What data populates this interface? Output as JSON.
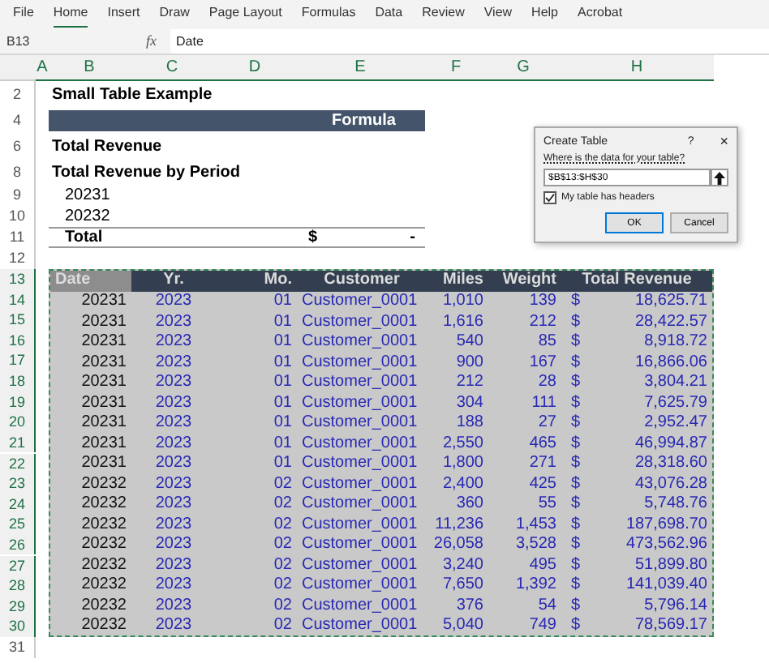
{
  "menu_tabs": [
    {
      "label": "File",
      "selected": false
    },
    {
      "label": "Home",
      "selected": true
    },
    {
      "label": "Insert",
      "selected": false
    },
    {
      "label": "Draw",
      "selected": false
    },
    {
      "label": "Page Layout",
      "selected": false
    },
    {
      "label": "Formulas",
      "selected": false
    },
    {
      "label": "Data",
      "selected": false
    },
    {
      "label": "Review",
      "selected": false
    },
    {
      "label": "View",
      "selected": false
    },
    {
      "label": "Help",
      "selected": false
    },
    {
      "label": "Acrobat",
      "selected": false
    }
  ],
  "formula_bar": {
    "name_box": "B13",
    "fx": "fx",
    "value": "Date"
  },
  "columns": [
    "A",
    "B",
    "C",
    "D",
    "E",
    "F",
    "G",
    "H"
  ],
  "rows": [
    {
      "num": "2",
      "kind": "title",
      "text": "Small Table Example"
    },
    {
      "num": "4",
      "kind": "band",
      "text": "Formula"
    },
    {
      "num": "6",
      "kind": "label",
      "text": "Total Revenue"
    },
    {
      "num": "8",
      "kind": "label",
      "text": "Total Revenue by Period"
    },
    {
      "num": "9",
      "kind": "period",
      "text": "20231"
    },
    {
      "num": "10",
      "kind": "period",
      "text": "20232"
    },
    {
      "num": "11",
      "kind": "total",
      "text": "Total",
      "currency": "$",
      "value": "-"
    },
    {
      "num": "12",
      "kind": "blank"
    }
  ],
  "table": {
    "header_row": "13",
    "columns": [
      {
        "label": "Date",
        "selected": true
      },
      {
        "label": "Yr.",
        "selected": false
      },
      {
        "label": "Mo.",
        "selected": false
      },
      {
        "label": "Customer",
        "selected": false
      },
      {
        "label": "Miles",
        "selected": false
      },
      {
        "label": "Weight",
        "selected": false
      },
      {
        "label": "Total Revenue",
        "selected": false
      }
    ],
    "rows": [
      {
        "num": "14",
        "cells": [
          "20231",
          "2023",
          "01",
          "Customer_0001",
          "1,010",
          "139",
          "18,625.71"
        ],
        "currency": "$"
      },
      {
        "num": "15",
        "cells": [
          "20231",
          "2023",
          "01",
          "Customer_0001",
          "1,616",
          "212",
          "28,422.57"
        ],
        "currency": "$"
      },
      {
        "num": "16",
        "cells": [
          "20231",
          "2023",
          "01",
          "Customer_0001",
          "540",
          "85",
          "8,918.72"
        ],
        "currency": "$"
      },
      {
        "num": "17",
        "cells": [
          "20231",
          "2023",
          "01",
          "Customer_0001",
          "900",
          "167",
          "16,866.06"
        ],
        "currency": "$"
      },
      {
        "num": "18",
        "cells": [
          "20231",
          "2023",
          "01",
          "Customer_0001",
          "212",
          "28",
          "3,804.21"
        ],
        "currency": "$"
      },
      {
        "num": "19",
        "cells": [
          "20231",
          "2023",
          "01",
          "Customer_0001",
          "304",
          "111",
          "7,625.79"
        ],
        "currency": "$"
      },
      {
        "num": "20",
        "cells": [
          "20231",
          "2023",
          "01",
          "Customer_0001",
          "188",
          "27",
          "2,952.47"
        ],
        "currency": "$"
      },
      {
        "num": "21",
        "cells": [
          "20231",
          "2023",
          "01",
          "Customer_0001",
          "2,550",
          "465",
          "46,994.87"
        ],
        "currency": "$"
      },
      {
        "num": "22",
        "cells": [
          "20231",
          "2023",
          "01",
          "Customer_0001",
          "1,800",
          "271",
          "28,318.60"
        ],
        "currency": "$"
      },
      {
        "num": "23",
        "cells": [
          "20232",
          "2023",
          "02",
          "Customer_0001",
          "2,400",
          "425",
          "43,076.28"
        ],
        "currency": "$"
      },
      {
        "num": "24",
        "cells": [
          "20232",
          "2023",
          "02",
          "Customer_0001",
          "360",
          "55",
          "5,748.76"
        ],
        "currency": "$"
      },
      {
        "num": "25",
        "cells": [
          "20232",
          "2023",
          "02",
          "Customer_0001",
          "11,236",
          "1,453",
          "187,698.70"
        ],
        "currency": "$"
      },
      {
        "num": "26",
        "cells": [
          "20232",
          "2023",
          "02",
          "Customer_0001",
          "26,058",
          "3,528",
          "473,562.96"
        ],
        "currency": "$"
      },
      {
        "num": "27",
        "cells": [
          "20232",
          "2023",
          "02",
          "Customer_0001",
          "3,240",
          "495",
          "51,899.80"
        ],
        "currency": "$"
      },
      {
        "num": "28",
        "cells": [
          "20232",
          "2023",
          "02",
          "Customer_0001",
          "7,650",
          "1,392",
          "141,039.40"
        ],
        "currency": "$"
      },
      {
        "num": "29",
        "cells": [
          "20232",
          "2023",
          "02",
          "Customer_0001",
          "376",
          "54",
          "5,796.14"
        ],
        "currency": "$"
      },
      {
        "num": "30",
        "cells": [
          "20232",
          "2023",
          "02",
          "Customer_0001",
          "5,040",
          "749",
          "78,569.17"
        ],
        "currency": "$"
      }
    ],
    "after_row": "31"
  },
  "dialog": {
    "title": "Create Table",
    "help": "?",
    "close": "×",
    "prompt": "Where is the data for your table?",
    "range": "$B$13:$H$30",
    "headers_label": "My table has headers",
    "headers_checked": true,
    "buttons": [
      {
        "label": "OK",
        "selected": true
      },
      {
        "label": "Cancel",
        "selected": false
      }
    ]
  }
}
